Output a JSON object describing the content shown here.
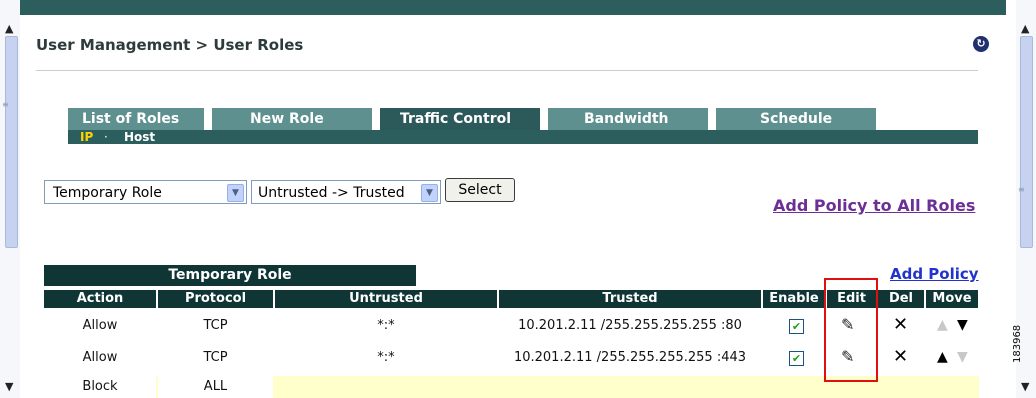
{
  "breadcrumb": "User Management > User Roles",
  "tabs": [
    {
      "label": "List of Roles"
    },
    {
      "label": "New Role"
    },
    {
      "label": "Traffic Control"
    },
    {
      "label": "Bandwidth"
    },
    {
      "label": "Schedule"
    }
  ],
  "active_tab": "Traffic Control",
  "subtabs": {
    "ip": "IP",
    "separator": "·",
    "host": "Host"
  },
  "filters": {
    "role_select": "Temporary Role",
    "direction_select": "Untrusted -> Trusted",
    "select_button": "Select"
  },
  "links": {
    "add_policy_all": "Add Policy to All Roles",
    "add_policy": "Add Policy"
  },
  "table": {
    "role_title": "Temporary Role",
    "headers": [
      "Action",
      "Protocol",
      "Untrusted",
      "Trusted",
      "Enable",
      "Edit",
      "Del",
      "Move"
    ],
    "rows": [
      {
        "action": "Allow",
        "protocol": "TCP",
        "untrusted": "*:*",
        "trusted": "10.201.2.11 /255.255.255.255 :80",
        "enabled": true,
        "move_up_enabled": false,
        "move_down_enabled": true
      },
      {
        "action": "Allow",
        "protocol": "TCP",
        "untrusted": "*:*",
        "trusted": "10.201.2.11 /255.255.255.255 :443",
        "enabled": true,
        "move_up_enabled": true,
        "move_down_enabled": false
      },
      {
        "action": "Block",
        "protocol": "ALL",
        "untrusted": "",
        "trusted": ""
      }
    ]
  },
  "icons": {
    "refresh": "refresh-icon",
    "edit": "edit-icon",
    "delete": "delete-icon",
    "move_up": "move-up-icon",
    "move_down": "move-down-icon"
  },
  "colors": {
    "header_dark": "#0f3535",
    "tab": "#5f9090",
    "tab_active": "#2c5a5a",
    "link_purple": "#6b2f96",
    "link_blue": "#2233cc",
    "highlight": "#e01010",
    "subtab_active": "#ffd300"
  },
  "figure_number": "183968"
}
